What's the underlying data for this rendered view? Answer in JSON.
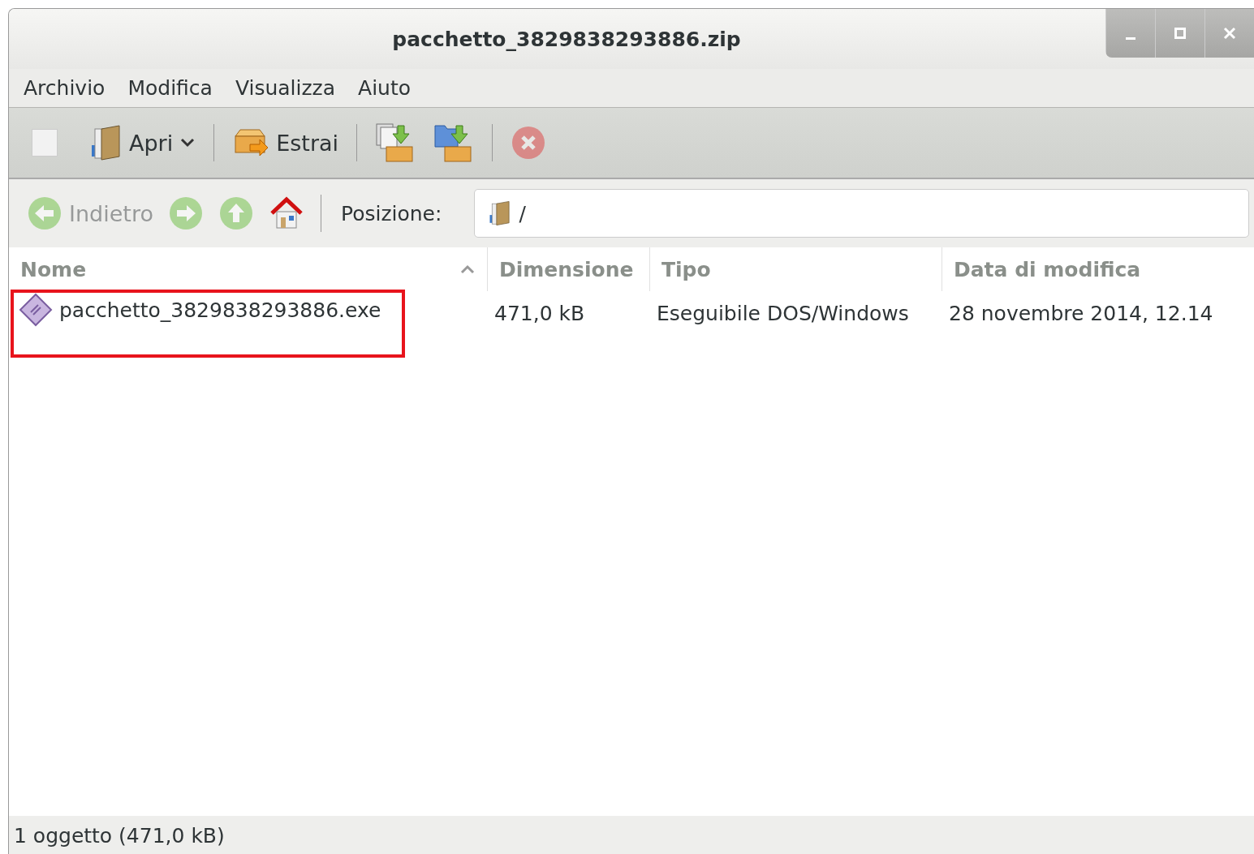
{
  "window": {
    "title": "pacchetto_3829838293886.zip"
  },
  "menu": [
    "Archivio",
    "Modifica",
    "Visualizza",
    "Aiuto"
  ],
  "toolbar": [
    {
      "kind": "check",
      "checked": false
    },
    {
      "kind": "open",
      "label": "Apri"
    },
    {
      "kind": "sep"
    },
    {
      "kind": "extract",
      "label": "Estrai"
    },
    {
      "kind": "sep"
    },
    {
      "kind": "add-files"
    },
    {
      "kind": "add-folder"
    },
    {
      "kind": "sep"
    },
    {
      "kind": "stop",
      "disabled": true
    }
  ],
  "navigation": [
    {
      "kind": "back",
      "label": "Indietro",
      "disabled": true
    },
    {
      "kind": "forward",
      "disabled": true
    },
    {
      "kind": "up",
      "disabled": true
    },
    {
      "kind": "home",
      "disabled": false
    }
  ],
  "location": {
    "label": "Posizione:",
    "value": "/"
  },
  "table": {
    "columns": [
      {
        "label": "Nome",
        "sorted": true
      },
      {
        "label": "Dimensione",
        "sorted": false
      },
      {
        "label": "Tipo",
        "sorted": false
      },
      {
        "label": "Data di modifica",
        "sorted": false
      }
    ],
    "rows": [
      {
        "name": "pacchetto_3829838293886.exe",
        "size": "471,0 kB",
        "type": "Eseguibile DOS/Windows",
        "modified": "28 novembre 2014, 12.14",
        "highlighted": true
      }
    ]
  },
  "status_bar": "1 oggetto (471,0 kB)"
}
